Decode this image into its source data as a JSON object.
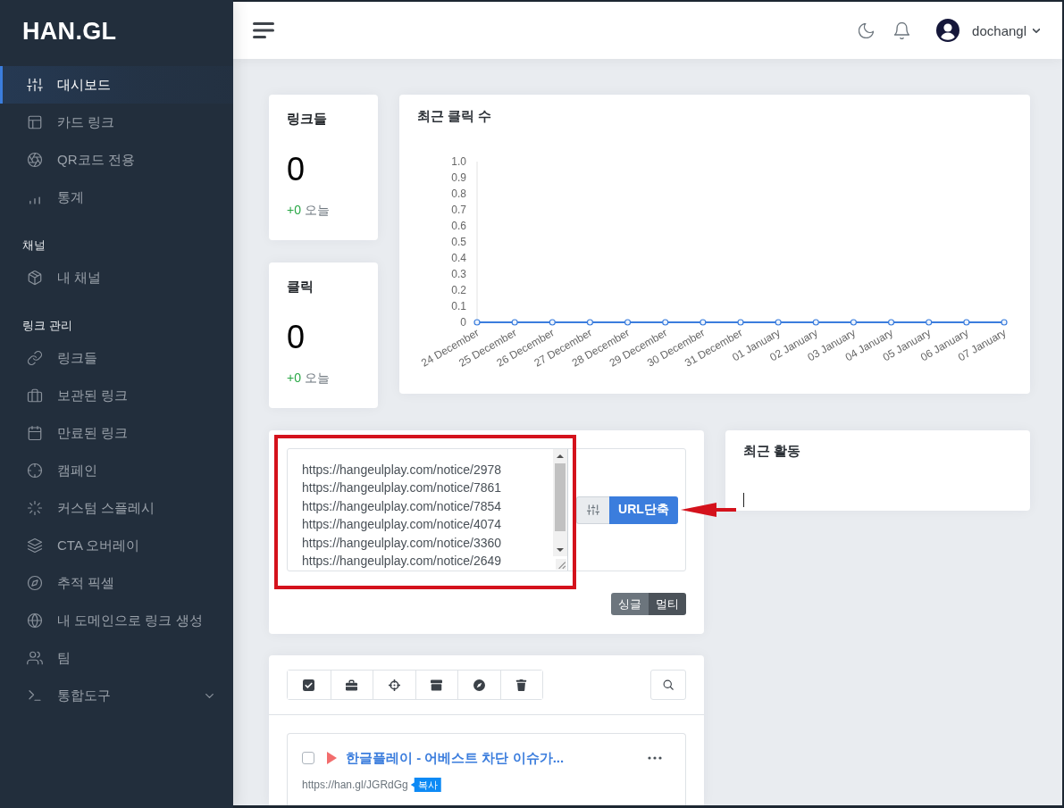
{
  "sidebar": {
    "logo": "HAN.GL",
    "groups": [
      {
        "items": [
          {
            "label": "대시보드",
            "kind": "link",
            "selected": true
          },
          {
            "label": "카드 링크",
            "kind": "link",
            "selected": false
          },
          {
            "label": "QR코드 전용",
            "kind": "link",
            "selected": false
          },
          {
            "label": "통계",
            "kind": "link",
            "selected": false
          }
        ]
      },
      {
        "header": "채널",
        "items": [
          {
            "label": "내 채널",
            "kind": "link",
            "selected": false
          }
        ]
      },
      {
        "header": "링크 관리",
        "items": [
          {
            "label": "링크들",
            "kind": "link",
            "selected": false
          },
          {
            "label": "보관된 링크",
            "kind": "link",
            "selected": false
          },
          {
            "label": "만료된 링크",
            "kind": "link",
            "selected": false
          },
          {
            "label": "캠페인",
            "kind": "link",
            "selected": false
          },
          {
            "label": "커스텀 스플레시",
            "kind": "link",
            "selected": false
          },
          {
            "label": "CTA 오버레이",
            "kind": "link",
            "selected": false
          },
          {
            "label": "추적 픽셀",
            "kind": "link",
            "selected": false
          },
          {
            "label": "내 도메인으로 링크 생성",
            "kind": "link",
            "selected": false
          },
          {
            "label": "팀",
            "kind": "link",
            "selected": false
          },
          {
            "label": "통합도구",
            "kind": "dropdown",
            "selected": false
          }
        ]
      }
    ]
  },
  "topbar": {
    "username": "dochangl"
  },
  "stats": [
    {
      "title": "링크들",
      "value": "0",
      "change": "+0",
      "period": "오늘"
    },
    {
      "title": "클릭",
      "value": "0",
      "change": "+0",
      "period": "오늘"
    }
  ],
  "clicks_chart": {
    "title": "최근 클릭 수",
    "chart_data": {
      "type": "line",
      "categories": [
        "24 December",
        "25 December",
        "26 December",
        "27 December",
        "28 December",
        "29 December",
        "30 December",
        "31 December",
        "01 January",
        "02 January",
        "03 January",
        "04 January",
        "05 January",
        "06 January",
        "07 January"
      ],
      "series": [
        {
          "color": "#3b7ddd",
          "marker": "circle",
          "values": [
            0,
            0,
            0,
            0,
            0,
            0,
            0,
            0,
            0,
            0,
            0,
            0,
            0,
            0,
            0
          ]
        }
      ],
      "ylim": [
        0,
        1
      ],
      "yticks": [
        0,
        0.1,
        0.2,
        0.3,
        0.4,
        0.5,
        0.6,
        0.7,
        0.8,
        0.9,
        {
          "value": 1,
          "label": "1.0"
        }
      ]
    }
  },
  "shortener": {
    "value_lines": [
      "https://hangeulplay.com/notice/2978",
      "https://hangeulplay.com/notice/7861",
      "https://hangeulplay.com/notice/7854",
      "https://hangeulplay.com/notice/4074",
      "https://hangeulplay.com/notice/3360",
      "https://hangeulplay.com/notice/2649"
    ],
    "submit_label": "URL단축",
    "modes": [
      {
        "label": "싱글",
        "selected": false
      },
      {
        "label": "멀티",
        "selected": true
      }
    ]
  },
  "activity": {
    "title": "최근 활동"
  },
  "links": {
    "items": [
      {
        "title": "한글플레이 - 어베스트 차단 이슈가...",
        "url": "https://han.gl/JGRdGg",
        "copy_label": "복사",
        "checked": false
      }
    ]
  }
}
